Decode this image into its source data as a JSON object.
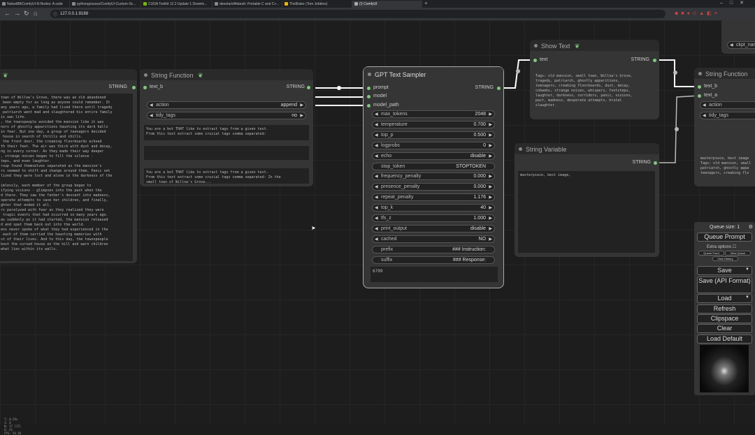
{
  "browser": {
    "tabs": [
      "Nuked88/ComfyUI-N-Nodes: A suite",
      "pythongosssss/ComfyUI-Custom-Sc...",
      "CUDA Toolkit 12.2 Update 1 Downlo...",
      "deeeta/oll4dandr: Portable C and C+...",
      "TheBrake (Tom Jobbins)",
      "(!) ComfyUI"
    ],
    "url": "127.0.0.1:8188"
  },
  "left_node": {
    "output_label": "STRING",
    "text": "town of Willow's Grove, there was an old abandoned\n been empty for as long as anyone could remember. It\nany years ago, a family had lived there until tragedy\n patriarch went mad and slaughtered his entire family\nis own life.\n, the townspeople avoided the mansion like it was\nnors of ghostly apparitions haunting its dark halls\nin fear. But one day, a group of teenagers decided\n house in search of thrills and chills.\n the front door, the creaking floorboards echoed\nth their feet. The air was thick with dust and decay,\nng in every corner. As they made their way deeper\n, strange noises began to fill the silence -\nteps, and even laughter.\nroup found themselves separated as the mansion's\nrs seemed to shift and change around them. Panic set\nlized they were lost and alone in the darkness of the\n\nimlessly, each member of the group began to\nifying visions - glimpses into the past when the\nd there. They saw the father's descent into madness,\nsperate attempts to save her children, and finally,\nghter that ended it all.\nrs paralyzed with fear as they realized they were\n tragic events that had occurred so many years ago.\nas suddenly as it had started, the mansion released\nd and spat them back out into the world.\nens never spoke of what they had experienced in the\n each of them carried the haunting memories with\nst of their lives. And to this day, the townspeople\nbout the cursed house on the hill and warn children\nwhat lies within its walls."
  },
  "string_function_1": {
    "title": "String Function",
    "input": "text_b",
    "output": "STRING",
    "action_label": "action",
    "action_value": "append",
    "tidy_label": "tidy_tags",
    "tidy_value": "no",
    "text_a": "You are a bot THAT like to extract tags from a given text.\nFrom this text extract some crucial tags comma separated:",
    "preview": "You are a bot THAT like to extract tags from a given text.\nFrom this text extract some crucial tags comma separated: In the\nsmall town of Willow's Grove..."
  },
  "gpt_sampler": {
    "title": "GPT Text Sampler",
    "inputs": [
      "prompt",
      "model",
      "model_path"
    ],
    "output": "STRING",
    "widgets": [
      {
        "label": "max_tokens",
        "value": "2048"
      },
      {
        "label": "temperature",
        "value": "0.700"
      },
      {
        "label": "top_p",
        "value": "0.500"
      },
      {
        "label": "logprobs",
        "value": "0"
      },
      {
        "label": "echo",
        "value": "disable"
      },
      {
        "label": "stop_token",
        "value": "STOPTOKEN"
      },
      {
        "label": "frequency_penalty",
        "value": "0.000"
      },
      {
        "label": "presence_penalty",
        "value": "0.000"
      },
      {
        "label": "repeat_penalty",
        "value": "1.176"
      },
      {
        "label": "top_k",
        "value": "40"
      },
      {
        "label": "tfs_z",
        "value": "1.000"
      },
      {
        "label": "print_output",
        "value": "disable"
      },
      {
        "label": "cached",
        "value": "NO"
      },
      {
        "label": "prefix",
        "value": "### Instruction:"
      },
      {
        "label": "suffix",
        "value": "### Response:"
      }
    ],
    "seed": "6799"
  },
  "show_text": {
    "title": "Show Text",
    "input": "text",
    "output": "STRING",
    "text": "Tags: old mansion, small town, Willow's Grove,\ntragedy, patriarch, ghostly apparitions,\nteenagers, creaking floorboards, dust, decay,\ncobwebs, strange noises, whispers, footsteps,\nlaughter, darkness, corridors, panic, visions,\npast, madness, desperate attempts, brutal\nslaughter."
  },
  "string_variable": {
    "title": "String Variable",
    "output": "STRING",
    "text": "masterpiece, best image,"
  },
  "string_function_2": {
    "title": "String Function",
    "inputs": [
      "text_b",
      "text_a"
    ],
    "action_label": "action",
    "tidy_label": "tidy_tags",
    "text": "masterpiece, best image\nTags: old mansion, small\npatriarch, ghostly appa\nteenagers, creaking flo"
  },
  "ckpt_node": {
    "label": "ckpt_nam"
  },
  "queue_panel": {
    "queue_size": "Queue size: 1",
    "queue_prompt": "Queue Prompt",
    "extra_options": "Extra options",
    "queue_front": "Queue Front",
    "view_queue": "View Queue",
    "view_history": "View History",
    "save": "Save",
    "save_api": "Save (API Format)",
    "load": "Load",
    "refresh": "Refresh",
    "clipspace": "Clipspace",
    "clear": "Clear",
    "load_default": "Load Default"
  },
  "stats": [
    "T: 0.29s",
    "I: 0",
    "N: 17 [17]",
    "V: 61",
    "FPS: 56.50"
  ],
  "colors": {
    "link": "#ffffff",
    "port": "#7ec97e",
    "node_bg": "#353535",
    "node_title": "#2a2a2a",
    "canvas": "#1d1d1d"
  }
}
